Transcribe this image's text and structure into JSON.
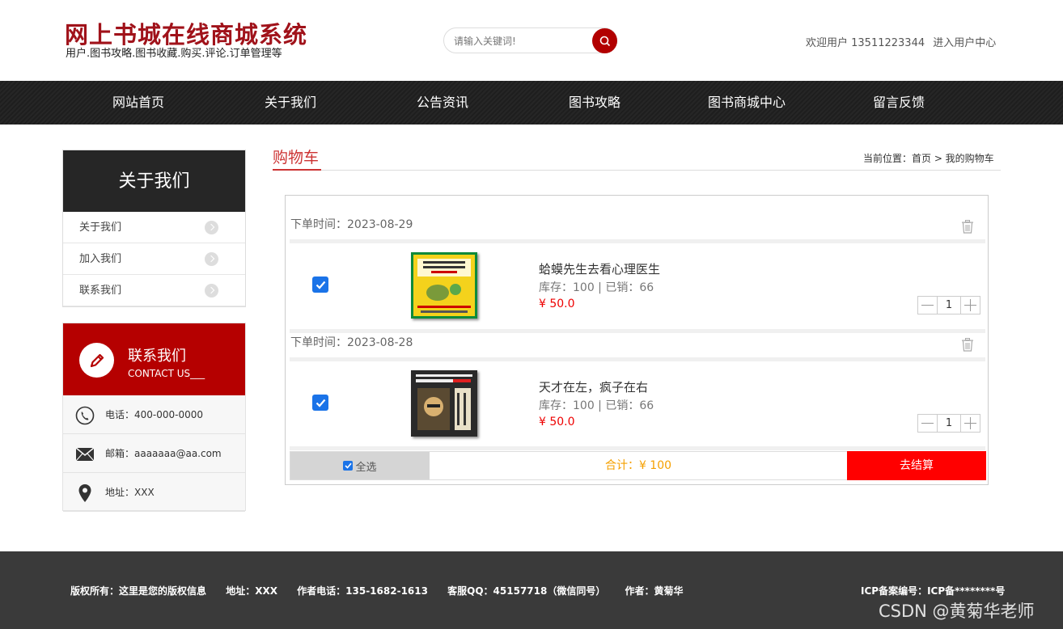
{
  "header": {
    "title": "网上书城在线商城系统",
    "subtitle": "用户.图书攻略.图书收藏.购买.评论.订单管理等",
    "search_placeholder": "请输入关键词!",
    "welcome": "欢迎用户 13511223344",
    "user_center": "进入用户中心"
  },
  "nav": {
    "items": [
      "网站首页",
      "关于我们",
      "公告资讯",
      "图书攻略",
      "图书商城中心",
      "留言反馈"
    ]
  },
  "sidebar": {
    "about_title": "关于我们",
    "links": [
      "关于我们",
      "加入我们",
      "联系我们"
    ],
    "contact_title": "联系我们",
    "contact_en": "CONTACT US___",
    "phone": "电话：400-000-0000",
    "email": "邮箱：aaaaaaa@aa.com",
    "address": "地址：XXX"
  },
  "main": {
    "title": "购物车",
    "breadcrumb": "当前位置：首页 > 我的购物车",
    "orders": [
      {
        "time": "下单时间：2023-08-29",
        "name": "蛤蟆先生去看心理医生",
        "stock": "库存：100 | 已销：66",
        "price": "¥ 50.0",
        "qty": "1",
        "checked": true
      },
      {
        "time": "下单时间：2023-08-28",
        "name": "天才在左，疯子在右",
        "stock": "库存：100 | 已销：66",
        "price": "¥ 50.0",
        "qty": "1",
        "checked": true
      }
    ],
    "select_all": "全选",
    "total": "合计：¥ 100",
    "checkout": "去结算"
  },
  "footer": {
    "copyright": "版权所有：这里是您的版权信息",
    "address": "地址：XXX",
    "phone": "作者电话：135-1682-1613",
    "qq": "客服QQ：45157718（微信同号）",
    "author": "作者：黄菊华",
    "icp": "ICP备案编号：ICP备********号"
  },
  "watermark": "CSDN @黄菊华老师",
  "colors": {
    "brand_red": "#b20000",
    "price_red": "#ee0000",
    "total_orange": "#f5a000"
  }
}
